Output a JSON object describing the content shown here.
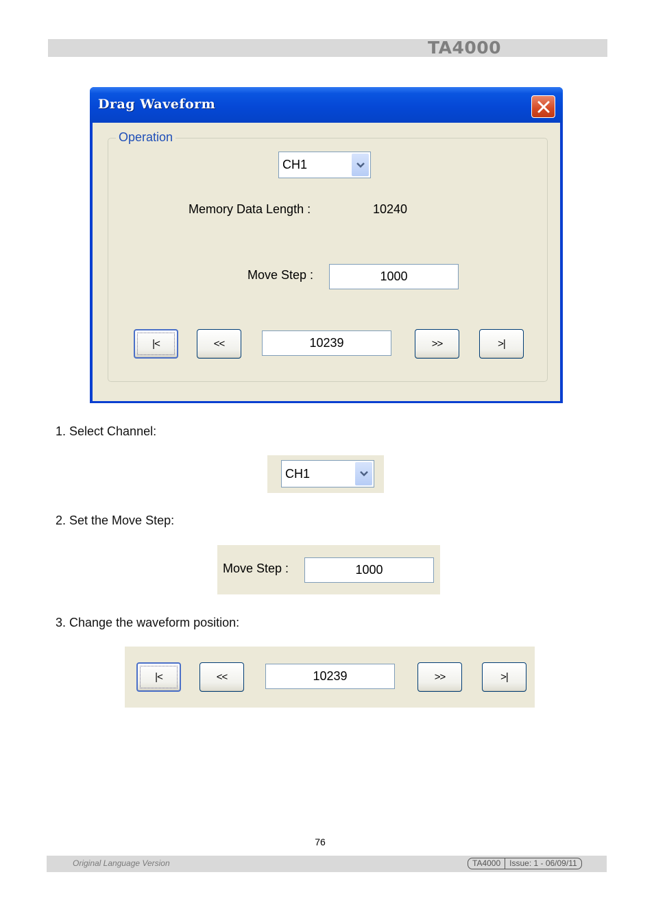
{
  "header": {
    "title": "TA4000"
  },
  "dialog": {
    "title": "Drag Waveform",
    "group_label": "Operation",
    "channel_select": {
      "value": "CH1"
    },
    "memory_label": "Memory Data Length :",
    "memory_value": "10240",
    "move_step_label": "Move Step :",
    "move_step_value": "1000",
    "buttons": {
      "first": "|<",
      "prev": "<<",
      "next": ">>",
      "last": ">|"
    },
    "position_value": "10239"
  },
  "steps": [
    {
      "text": "1. Select Channel:"
    },
    {
      "text": "2. Set the Move Step:"
    },
    {
      "text": "3. Change the waveform position:"
    }
  ],
  "snippets": {
    "channel_value": "CH1",
    "move_step_label": "Move Step :",
    "move_step_value": "1000",
    "buttons": {
      "first": "|<",
      "prev": "<<",
      "next": ">>",
      "last": ">|"
    },
    "position_value": "10239"
  },
  "footer": {
    "page_number": "76",
    "left_text": "Original Language Version",
    "model": "TA4000",
    "issue": "Issue: 1 - 06/09/11"
  },
  "colors": {
    "titlebar_blue": "#0548d6",
    "dialog_bg": "#ece9d8",
    "close_red": "#d44a24",
    "header_gray": "#d9d9d9"
  }
}
